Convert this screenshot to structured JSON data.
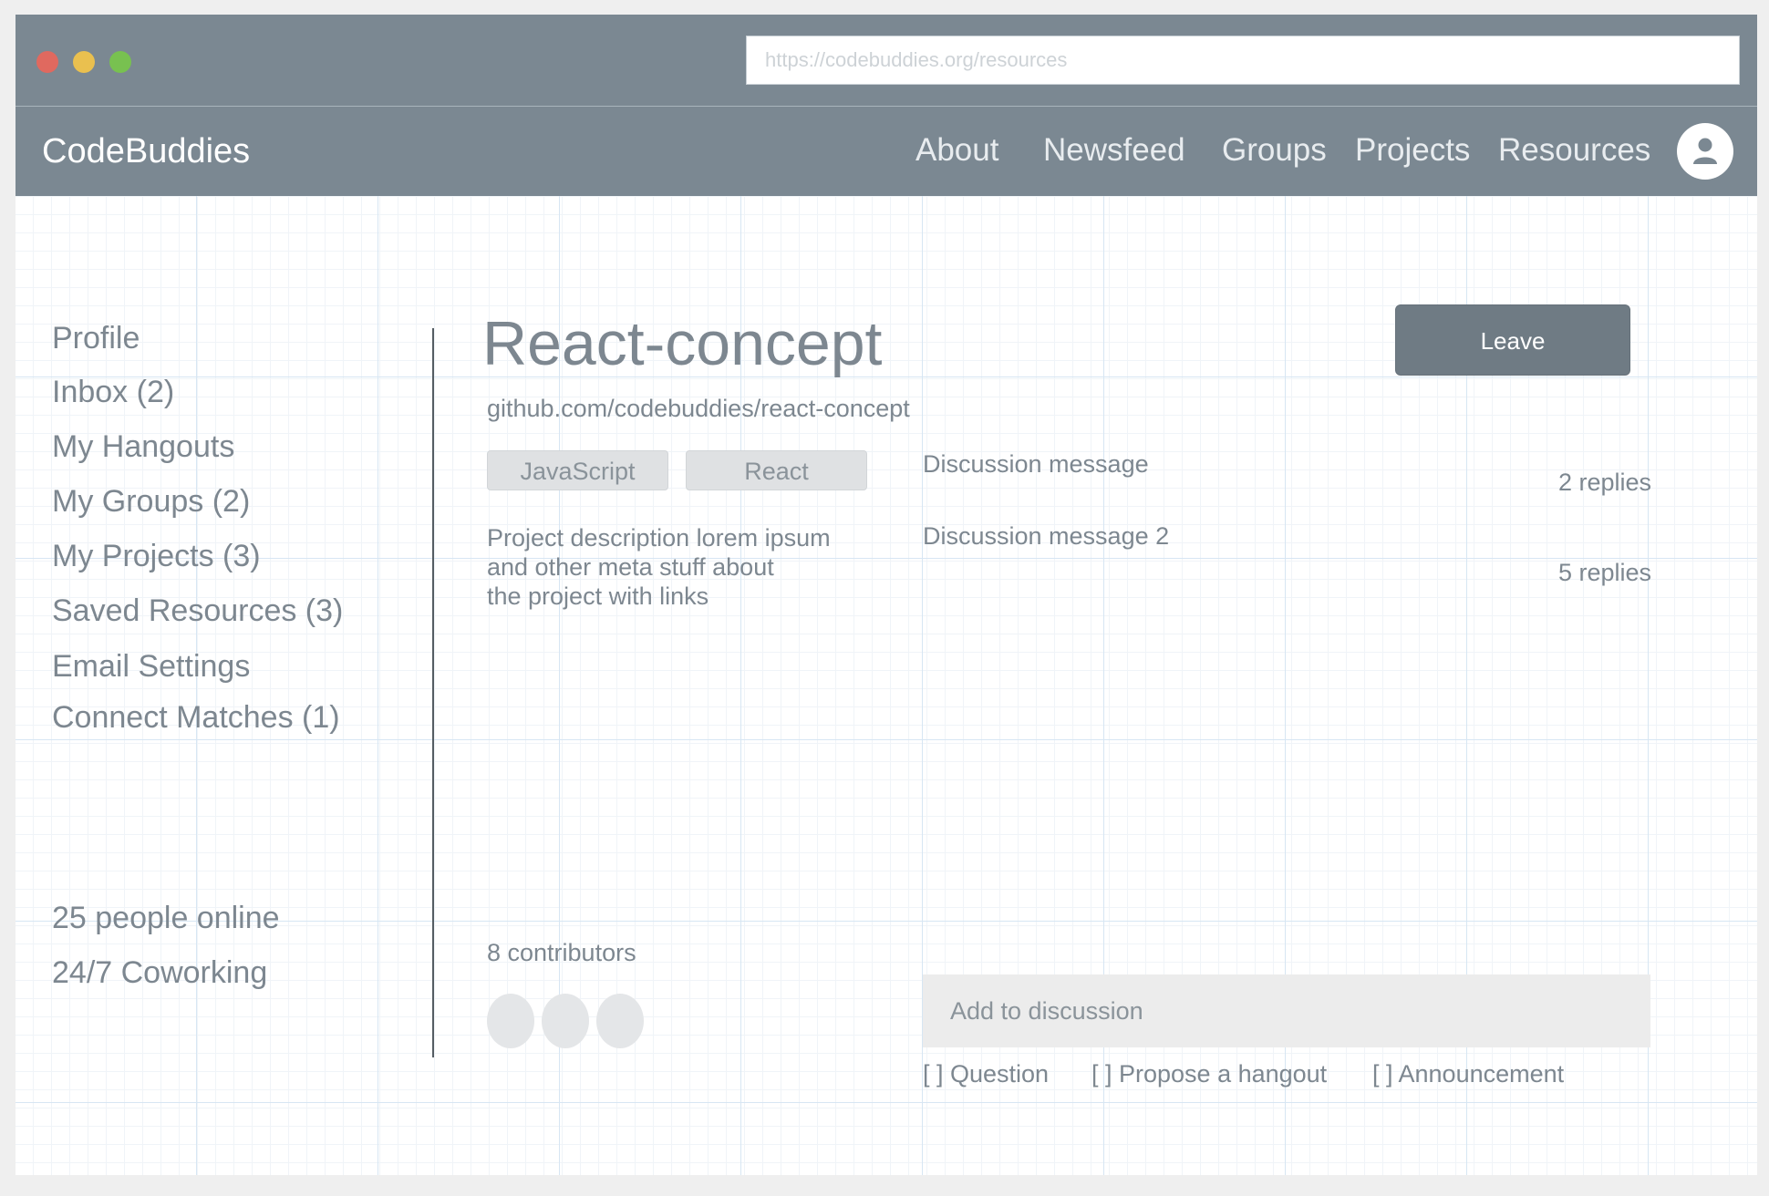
{
  "browser": {
    "url": "https://codebuddies.org/resources",
    "traffic_light_colors": [
      "#e0695f",
      "#eac04f",
      "#78c150"
    ]
  },
  "header": {
    "brand": "CodeBuddies",
    "nav": [
      "About",
      "Newsfeed",
      "Groups",
      "Projects",
      "Resources"
    ],
    "avatar_icon": "user-icon"
  },
  "sidebar": {
    "items": [
      {
        "label": "Profile"
      },
      {
        "label": "Inbox (2)"
      },
      {
        "label": "My Hangouts"
      },
      {
        "label": "My Groups (2)"
      },
      {
        "label": "My Projects (3)"
      },
      {
        "label": "Saved Resources (3)"
      },
      {
        "label": "Email Settings"
      },
      {
        "label": "Connect Matches (1)"
      }
    ],
    "online": "25 people online",
    "coworking": "24/7 Coworking"
  },
  "project": {
    "title": "React-concept",
    "repo": "github.com/codebuddies/react-concept",
    "tags": [
      "JavaScript",
      "React"
    ],
    "description": [
      "Project description lorem ipsum",
      "and other meta stuff about",
      "the project with links"
    ],
    "leave_label": "Leave",
    "contributors_label": "8 contributors"
  },
  "discussion": {
    "messages": [
      {
        "text": "Discussion message",
        "replies": "2 replies"
      },
      {
        "text": "Discussion message 2",
        "replies": "5 replies"
      }
    ],
    "input_placeholder": "Add to discussion",
    "options": [
      "[ ] Question",
      "[ ] Propose a hangout",
      "[ ] Announcement"
    ]
  },
  "colors": {
    "header_bg": "#7b8892",
    "button_bg": "#6f7b84",
    "text": "#7d8790"
  }
}
